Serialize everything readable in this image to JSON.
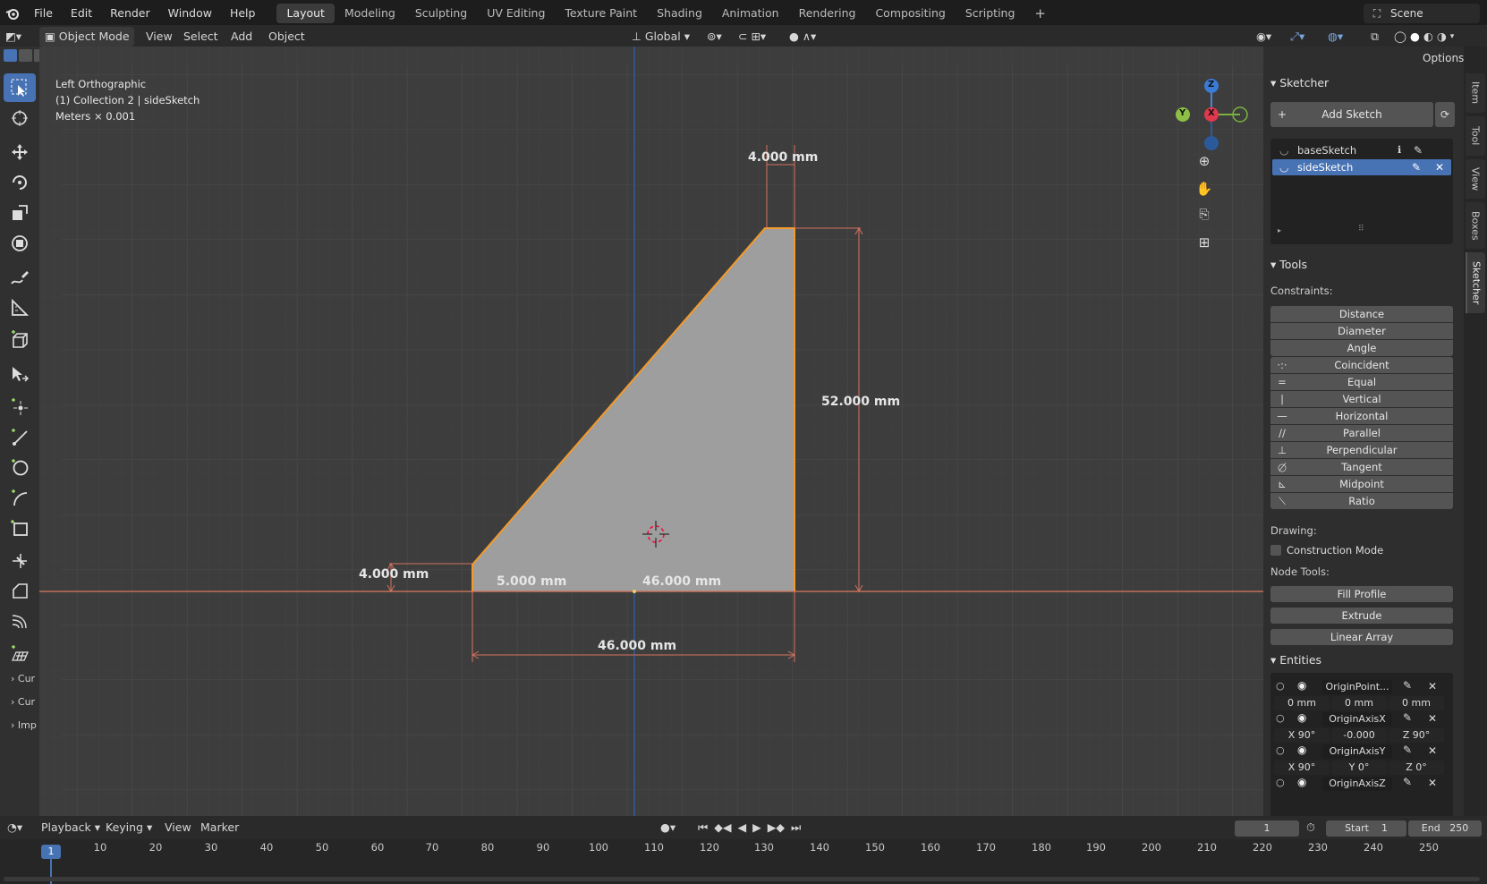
{
  "topbar": {
    "menus": [
      "File",
      "Edit",
      "Render",
      "Window",
      "Help"
    ],
    "workspaces": [
      "Layout",
      "Modeling",
      "Sculpting",
      "UV Editing",
      "Texture Paint",
      "Shading",
      "Animation",
      "Rendering",
      "Compositing",
      "Scripting"
    ],
    "active_workspace": "Layout",
    "scene": "Scene"
  },
  "header": {
    "mode": "Object Mode",
    "menus": [
      "View",
      "Select",
      "Add",
      "Object"
    ],
    "transform_orientation": "Global",
    "options": "Options"
  },
  "viewport": {
    "view_name": "Left Orthographic",
    "collection": "(1) Collection 2 | sideSketch",
    "units": "Meters × 0.001",
    "dimensions": {
      "top_width": "4.000 mm",
      "height": "52.000 mm",
      "left_height": "4.000 mm",
      "left_offset": "5.000 mm",
      "bottom_inner": "46.000 mm",
      "bottom_total": "46.000 mm"
    },
    "gizmo": {
      "z": "Z",
      "y": "Y",
      "x": "X"
    }
  },
  "toolbar": {
    "collapsed": [
      "Cur",
      "Cur",
      "Imp"
    ]
  },
  "sketcher": {
    "title": "Sketcher",
    "add_sketch": "Add Sketch",
    "sketches": [
      {
        "name": "baseSketch",
        "active": false
      },
      {
        "name": "sideSketch",
        "active": true
      }
    ]
  },
  "tools": {
    "title": "Tools",
    "constraints_label": "Constraints:",
    "constraints_plain": [
      "Distance",
      "Diameter",
      "Angle"
    ],
    "constraints_icon": [
      "Coincident",
      "Equal",
      "Vertical",
      "Horizontal",
      "Parallel",
      "Perpendicular",
      "Tangent",
      "Midpoint",
      "Ratio"
    ],
    "drawing_label": "Drawing:",
    "construction_mode": "Construction Mode",
    "node_tools_label": "Node Tools:",
    "node_tools": [
      "Fill Profile",
      "Extrude",
      "Linear Array"
    ]
  },
  "entities": {
    "title": "Entities",
    "items": [
      {
        "name": "OriginPoint...",
        "fields": [
          "0 mm",
          "0 mm",
          "0 mm"
        ]
      },
      {
        "name": "OriginAxisX",
        "fields": [
          "X  90°",
          "-0.000",
          "Z  90°"
        ]
      },
      {
        "name": "OriginAxisY",
        "fields": [
          "X  90°",
          "Y    0°",
          "Z    0°"
        ]
      },
      {
        "name": "OriginAxisZ",
        "fields": []
      }
    ]
  },
  "right_tabs": [
    "Item",
    "Tool",
    "View",
    "Boxes",
    "Sketcher"
  ],
  "active_right_tab": "Sketcher",
  "timeline": {
    "menus": [
      "Playback",
      "Keying",
      "View",
      "Marker"
    ],
    "current_frame": "1",
    "start_label": "Start",
    "start": "1",
    "end_label": "End",
    "end": "250",
    "ticks": [
      "1",
      "10",
      "20",
      "30",
      "40",
      "50",
      "60",
      "70",
      "80",
      "90",
      "100",
      "110",
      "120",
      "130",
      "140",
      "150",
      "160",
      "170",
      "180",
      "190",
      "200",
      "210",
      "220",
      "230",
      "240",
      "250"
    ]
  }
}
